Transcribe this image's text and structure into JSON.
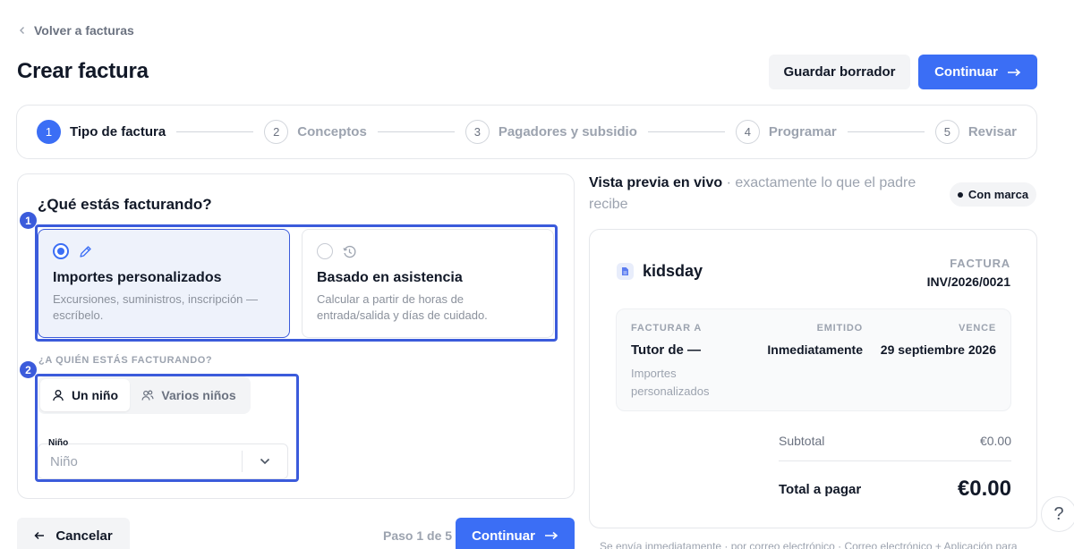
{
  "nav": {
    "back_label": "Volver a facturas"
  },
  "header": {
    "title": "Crear factura",
    "draft_label": "Guardar borrador",
    "continue_label": "Continuar"
  },
  "stepper": {
    "steps": [
      {
        "num": "1",
        "label": "Tipo de factura",
        "active": true
      },
      {
        "num": "2",
        "label": "Conceptos",
        "active": false
      },
      {
        "num": "3",
        "label": "Pagadores y subsidio",
        "active": false
      },
      {
        "num": "4",
        "label": "Programar",
        "active": false
      },
      {
        "num": "5",
        "label": "Revisar",
        "active": false
      }
    ]
  },
  "form": {
    "question": "¿Qué estás facturando?",
    "options": [
      {
        "title": "Importes personalizados",
        "desc": "Excursiones, suministros, inscripción — escríbelo.",
        "selected": true,
        "icon": "pencil-icon"
      },
      {
        "title": "Basado en asistencia",
        "desc": "Calcular a partir de horas de entrada/salida y días de cuidado.",
        "selected": false,
        "icon": "clock-history-icon"
      }
    ],
    "who_label": "¿A QUIÉN ESTÁS FACTURANDO?",
    "segments": [
      {
        "label": "Un niño",
        "icon": "user-icon",
        "active": true
      },
      {
        "label": "Varios niños",
        "icon": "users-icon",
        "active": false
      }
    ],
    "child_field_label": "Niño",
    "child_placeholder": "Niño"
  },
  "annotations": {
    "marker_1": "1",
    "marker_2": "2"
  },
  "footer": {
    "cancel_label": "Cancelar",
    "step_count": "Paso 1 de 5",
    "continue_label": "Continuar"
  },
  "preview": {
    "title": "Vista previa en vivo",
    "subtitle": " · exactamente lo que el padre recibe",
    "brand_badge": "Con marca",
    "invoice": {
      "brand": "kidsday",
      "kind": "FACTURA",
      "number": "INV/2026/0021",
      "bill_to_label": "FACTURAR A",
      "bill_to_value": "Tutor de —",
      "bill_to_sub": "Importes personalizados",
      "issued_label": "EMITIDO",
      "issued_value": "Inmediatamente",
      "due_label": "VENCE",
      "due_value": "29 septiembre 2026",
      "subtotal_label": "Subtotal",
      "subtotal_value": "€0.00",
      "total_label": "Total a pagar",
      "total_value": "€0.00"
    },
    "footnote": "Se envía inmediatamente · por correo electrónico · Correo electrónico + Aplicación para"
  },
  "help": {
    "label": "?"
  },
  "colors": {
    "primary": "#3b6ef5",
    "annotation": "#3b5bdb",
    "muted": "#9ca3af"
  }
}
